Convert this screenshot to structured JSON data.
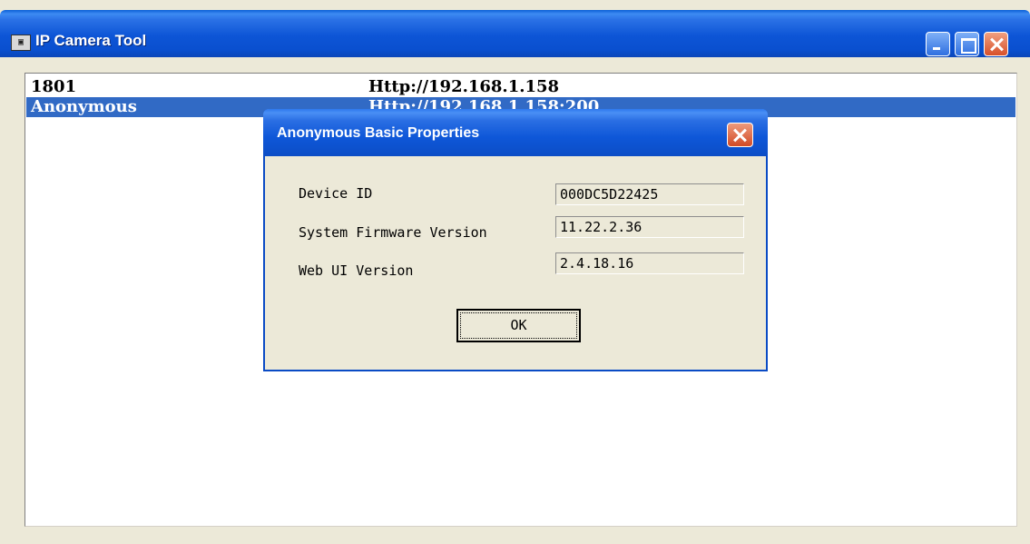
{
  "window": {
    "title": "IP Camera Tool",
    "app_icon": "camera-app-icon",
    "controls": [
      "minimize-icon",
      "maximize-icon",
      "close-icon"
    ],
    "accent_color": "#0a4fcf"
  },
  "camera_list": {
    "rows": [
      {
        "name": "1801",
        "url": "Http://192.168.1.158"
      },
      {
        "name": "Anonymous",
        "url": "Http://192.168.1.158:200"
      }
    ],
    "selected_index": 1,
    "selection_color": "#316ac5"
  },
  "dialog": {
    "title": "Anonymous Basic Properties",
    "properties": [
      {
        "label": "Device ID",
        "value": "000DC5D22425"
      },
      {
        "label": "System Firmware Version",
        "value": "11.22.2.36"
      },
      {
        "label": "Web UI Version",
        "value": "2.4.18.16"
      }
    ],
    "ok_label": "OK"
  }
}
